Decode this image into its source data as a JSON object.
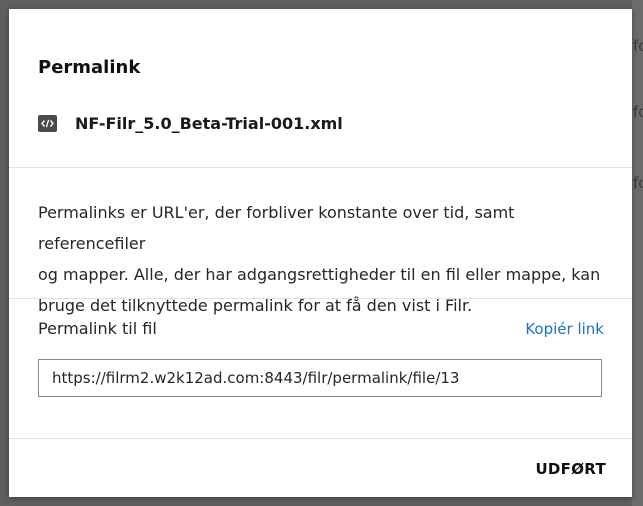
{
  "background": {
    "fragments": [
      "fo",
      "fo",
      "fo"
    ]
  },
  "dialog": {
    "title": "Permalink",
    "file": {
      "icon": "code-file-icon",
      "name": "NF-Filr_5.0_Beta-Trial-001.xml"
    },
    "description": [
      "Permalinks er URL'er, der forbliver konstante over tid, samt referencefiler",
      "og mapper. Alle, der har adgangsrettigheder til en fil eller mappe, kan",
      "bruge det tilknyttede permalink for at få den vist i Filr."
    ],
    "link_label": "Permalink til fil",
    "copy_link_label": "Kopiér link",
    "url": "https://filrm2.w2k12ad.com:8443/filr/permalink/file/13",
    "done_label": "UDFØRT"
  },
  "colors": {
    "accent": "#1a73c8",
    "overlay": "#5f5f5f",
    "icon": "#4a4a4a"
  }
}
